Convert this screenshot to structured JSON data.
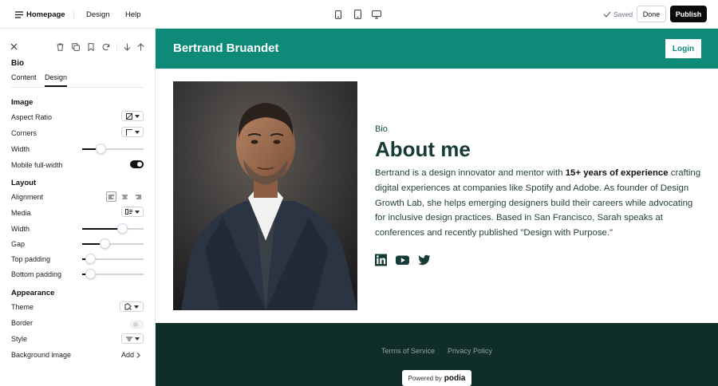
{
  "topbar": {
    "page_menu_label": "Homepage",
    "nav_design": "Design",
    "nav_help": "Help",
    "saved_label": "Saved",
    "done_label": "Done",
    "publish_label": "Publish",
    "device_icons": [
      "mobile-icon",
      "tablet-icon",
      "desktop-icon"
    ]
  },
  "panel": {
    "title": "Bio",
    "tabs": [
      "Content",
      "Design"
    ],
    "active_tab": "Design",
    "toolbar_icons": [
      "close-icon",
      "trash-icon",
      "duplicate-icon",
      "bookmark-icon",
      "refresh-icon",
      "move-down-icon",
      "move-up-icon"
    ],
    "sections": {
      "image": {
        "title": "Image",
        "aspect_ratio_label": "Aspect Ratio",
        "corners_label": "Corners",
        "width_label": "Width",
        "width_value": 0.3,
        "mobile_label": "Mobile full-width",
        "mobile_on": true
      },
      "layout": {
        "title": "Layout",
        "alignment_label": "Alignment",
        "alignment_selected": "left",
        "media_label": "Media",
        "width_label": "Width",
        "width_value": 0.65,
        "gap_label": "Gap",
        "gap_value": 0.36,
        "top_padding_label": "Top padding",
        "top_padding_value": 0.13,
        "bottom_padding_label": "Bottom padding",
        "bottom_padding_value": 0.13
      },
      "appearance": {
        "title": "Appearance",
        "theme_label": "Theme",
        "border_label": "Border",
        "border_on": false,
        "style_label": "Style",
        "background_label": "Background image",
        "add_label": "Add"
      }
    }
  },
  "site": {
    "brand": "Bertrand Bruandet",
    "login_label": "Login",
    "eyebrow": "Bio",
    "heading": "About me",
    "bio_part1": "Bertrand is a design innovator and mentor with ",
    "bio_bold": "15+ years of experience",
    "bio_part2": " crafting digital experiences at companies like Spotify and Adobe. As founder of Design Growth Lab, she helps emerging designers build their careers while advocating for inclusive design practices. Based in San Francisco, Sarah speaks at conferences and recently published \"Design with Purpose.\"",
    "social_icons": [
      "linkedin-icon",
      "youtube-icon",
      "twitter-icon"
    ],
    "footer_links": [
      "Terms of Service",
      "Privacy Policy"
    ],
    "powered_by": "Powered by",
    "powered_brand": "podia"
  },
  "colors": {
    "accent": "#0e8a78",
    "footer": "#0f2e2a",
    "heading": "#163b36",
    "publish": "#0b0b0b"
  }
}
